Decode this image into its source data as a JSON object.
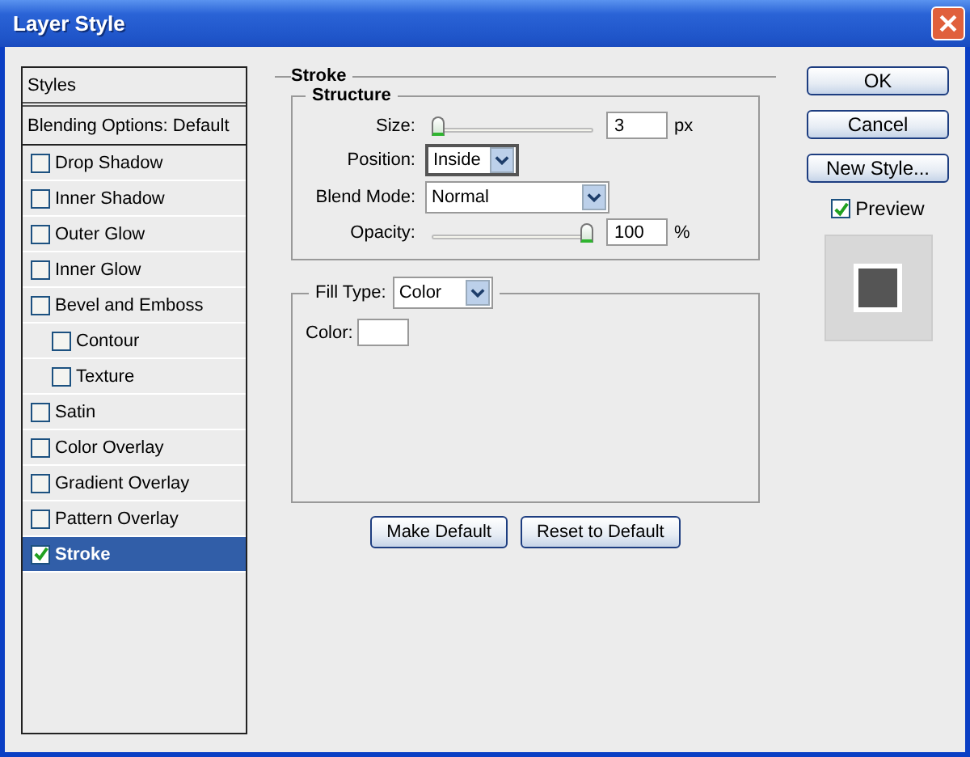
{
  "window": {
    "title": "Layer Style"
  },
  "styles_list": {
    "header": "Styles",
    "blending": "Blending Options: Default",
    "items": [
      {
        "label": "Drop Shadow",
        "checked": false,
        "selected": false
      },
      {
        "label": "Inner Shadow",
        "checked": false,
        "selected": false
      },
      {
        "label": "Outer Glow",
        "checked": false,
        "selected": false
      },
      {
        "label": "Inner Glow",
        "checked": false,
        "selected": false
      },
      {
        "label": "Bevel and Emboss",
        "checked": false,
        "selected": false,
        "children": [
          {
            "label": "Contour",
            "checked": false,
            "selected": false
          },
          {
            "label": "Texture",
            "checked": false,
            "selected": false
          }
        ]
      },
      {
        "label": "Satin",
        "checked": false,
        "selected": false
      },
      {
        "label": "Color Overlay",
        "checked": false,
        "selected": false
      },
      {
        "label": "Gradient Overlay",
        "checked": false,
        "selected": false
      },
      {
        "label": "Pattern Overlay",
        "checked": false,
        "selected": false
      },
      {
        "label": "Stroke",
        "checked": true,
        "selected": true
      }
    ]
  },
  "stroke": {
    "title": "Stroke",
    "structure": {
      "title": "Structure",
      "size": {
        "label": "Size:",
        "level": 0,
        "value": "3",
        "unit": "px"
      },
      "position": {
        "label": "Position:",
        "value": "Inside"
      },
      "blend_mode": {
        "label": "Blend Mode:",
        "value": "Normal"
      },
      "opacity": {
        "label": "Opacity:",
        "level": 1,
        "value": "100",
        "unit": "%"
      }
    },
    "fill": {
      "label": "Fill Type:",
      "value": "Color",
      "color_label": "Color:",
      "color": "#ffffff"
    },
    "buttons": [
      "Make Default",
      "Reset to Default"
    ]
  },
  "buttons": [
    "OK",
    "Cancel",
    "New Style..."
  ],
  "preview": {
    "label": "Preview",
    "checked": true
  }
}
